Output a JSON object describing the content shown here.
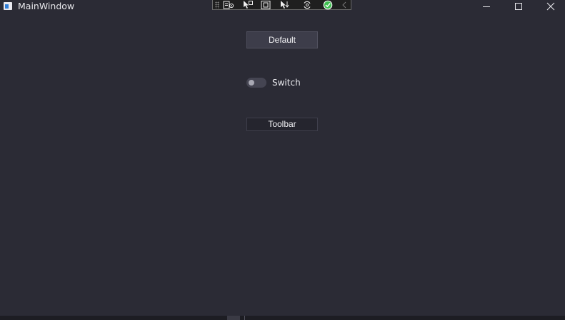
{
  "window": {
    "title": "MainWindow",
    "controls": {
      "minimize_icon": "minimize-icon",
      "maximize_icon": "maximize-icon",
      "close_icon": "close-icon"
    }
  },
  "debug_toolbar": {
    "buttons": [
      {
        "icon": "select-widget-icon"
      },
      {
        "icon": "pointer-icon"
      },
      {
        "icon": "frame-icon"
      },
      {
        "icon": "move-pointer-icon"
      },
      {
        "icon": "refresh-icon"
      },
      {
        "icon": "check-icon",
        "color": "#3fbf50"
      },
      {
        "icon": "collapse-icon"
      }
    ]
  },
  "main": {
    "default_button_label": "Default",
    "switch": {
      "label": "Switch",
      "checked": false
    },
    "toolbar_button_label": "Toolbar"
  },
  "colors": {
    "background": "#2b2b35",
    "button_bg": "#3d3d4a",
    "text": "#f0f0f3"
  }
}
